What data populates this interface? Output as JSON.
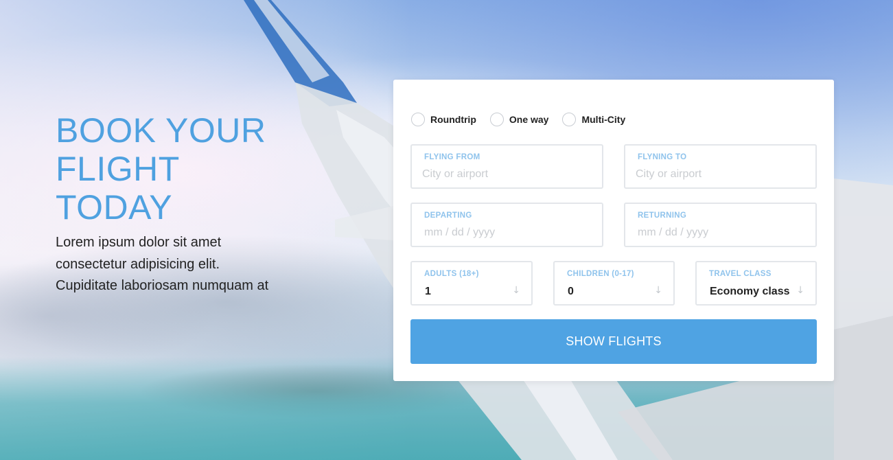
{
  "hero": {
    "title": "BOOK YOUR\nFLIGHT\nTODAY",
    "subtitle": "Lorem ipsum dolor sit amet\nconsectetur adipisicing elit.\nCupiditate laboriosam numquam at"
  },
  "trip_types": [
    {
      "label": "Roundtrip",
      "selected": false
    },
    {
      "label": "One way",
      "selected": false
    },
    {
      "label": "Multi-City",
      "selected": false
    }
  ],
  "fields": {
    "flying_from": {
      "label": "FLYING FROM",
      "placeholder": "City or airport"
    },
    "flying_to": {
      "label": "FLYNING TO",
      "placeholder": "City or airport"
    },
    "departing": {
      "label": "DEPARTING",
      "placeholder": "mm / dd / yyyy"
    },
    "returning": {
      "label": "RETURNING",
      "placeholder": "mm / dd / yyyy"
    },
    "adults": {
      "label": "ADULTS (18+)",
      "value": "1"
    },
    "children": {
      "label": "CHILDREN (0-17)",
      "value": "0"
    },
    "travel_class": {
      "label": "TRAVEL CLASS",
      "value": "Economy class"
    }
  },
  "select_arrow_icon": "arrow-down-icon",
  "submit_label": "SHOW FLIGHTS",
  "colors": {
    "accent": "#4fa3e3",
    "title": "#4fa1e0",
    "field_label": "#8fc3ec"
  }
}
